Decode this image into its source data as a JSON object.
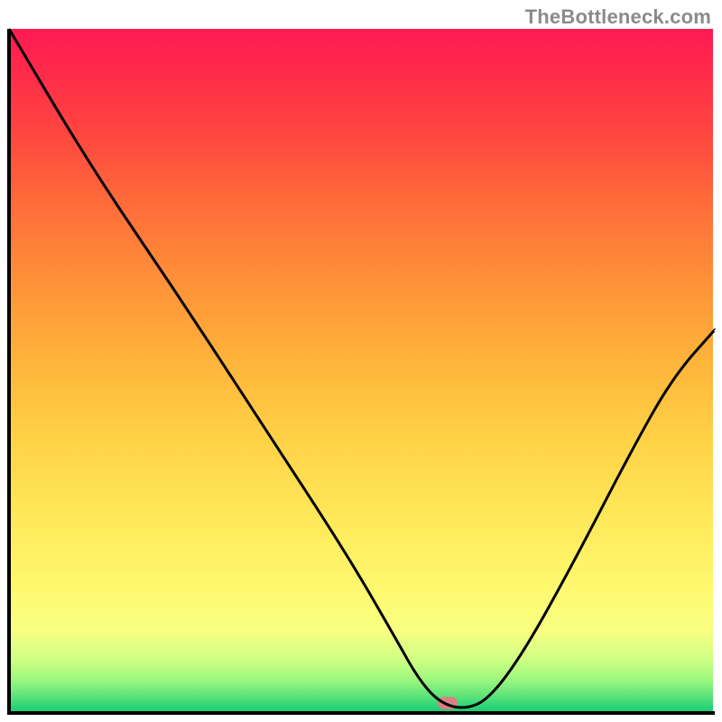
{
  "watermark": "TheBottleneck.com",
  "marker": {
    "x_pct": 0.622,
    "y_pct": 0.985
  },
  "chart_data": {
    "type": "line",
    "title": "",
    "xlabel": "",
    "ylabel": "",
    "ylim": [
      0,
      100
    ],
    "xlim": [
      0,
      100
    ],
    "x": [
      0.0,
      11.5,
      24.0,
      36.0,
      48.0,
      55.0,
      58.0,
      61.0,
      64.5,
      68.0,
      73.0,
      80.0,
      88.0,
      94.0,
      100.0
    ],
    "values": [
      100.0,
      80.0,
      61.0,
      42.0,
      23.0,
      10.5,
      5.0,
      1.5,
      0.5,
      2.0,
      9.0,
      22.0,
      38.0,
      49.0,
      56.0
    ],
    "annotations": [
      {
        "type": "marker",
        "shape": "pill",
        "color": "#d98083",
        "x": 62.2,
        "y": 1.5
      }
    ],
    "background_gradient": {
      "direction": "top-to-bottom",
      "top": "#ff1a53",
      "mid": "#ffe95a",
      "bottom": "#17c974"
    }
  }
}
